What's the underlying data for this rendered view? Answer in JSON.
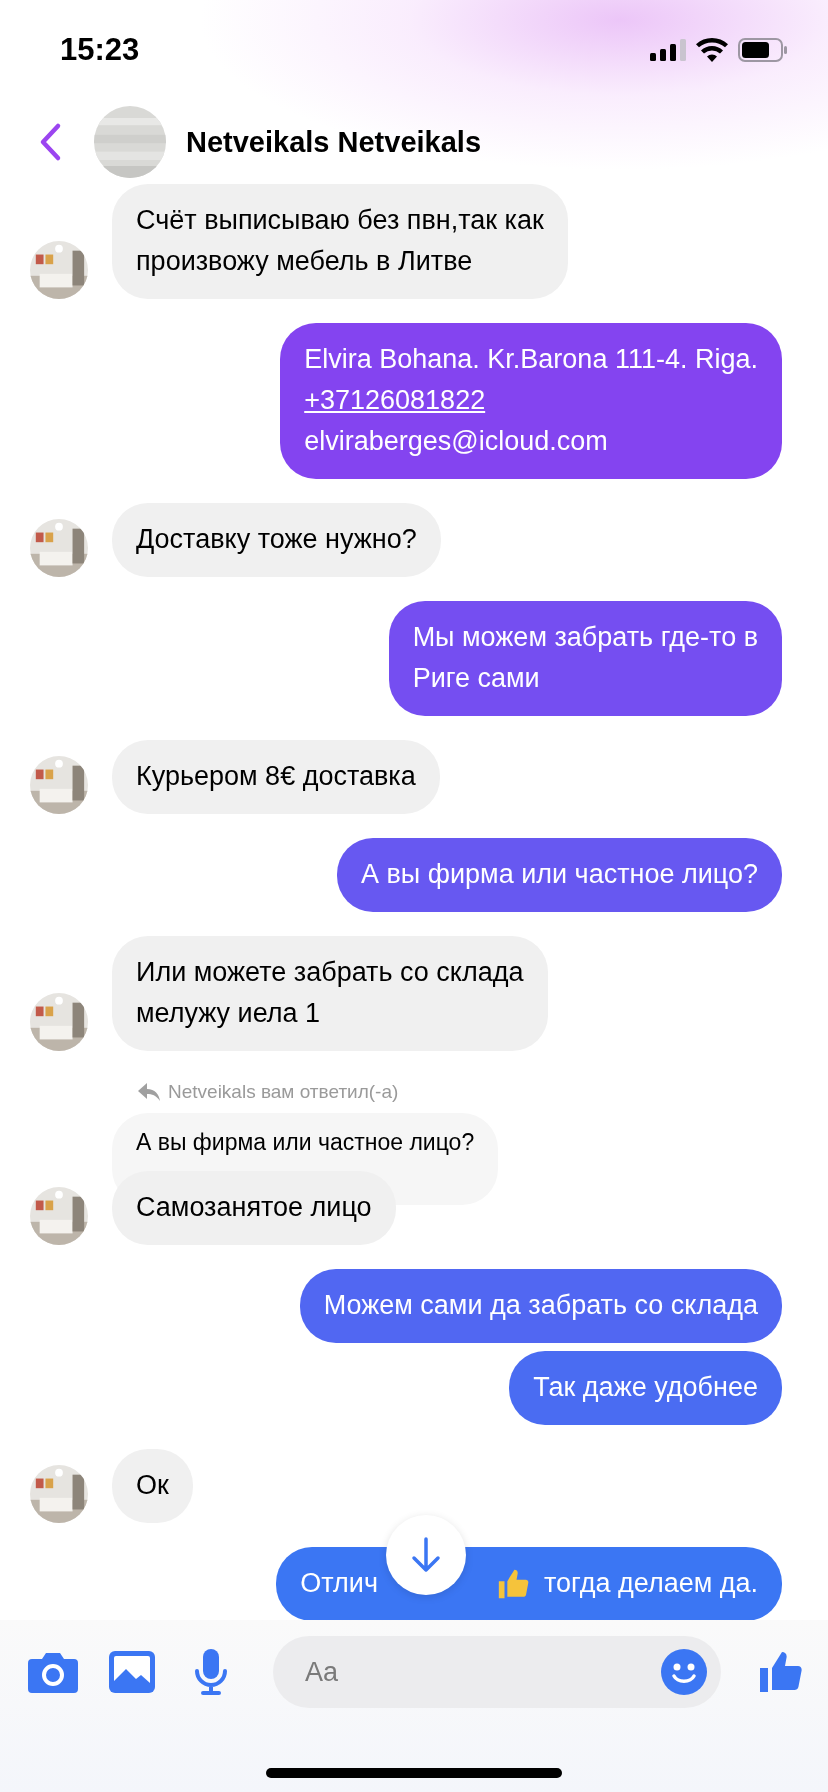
{
  "status_bar": {
    "time": "15:23"
  },
  "header": {
    "title": "Netveikals Netveikals"
  },
  "messages": [
    {
      "kind": "incoming",
      "text": "Счёт выписываю без пвн,так как\nпроизвожу мебель в Литве",
      "avatar": true
    },
    {
      "kind": "outgoing",
      "segments": [
        {
          "text": "Elvira Bohana. Kr.Barona 111-4. Riga.",
          "link": false
        },
        {
          "text": "+37126081822",
          "link": true
        },
        {
          "text": "elviraberges@icloud.com",
          "link": false
        }
      ]
    },
    {
      "kind": "incoming",
      "text": "Доставку тоже нужно?",
      "avatar": true
    },
    {
      "kind": "outgoing",
      "text": "Мы можем забрать где-то в\nРиге сами"
    },
    {
      "kind": "incoming",
      "text": "Курьером 8€ доставка",
      "avatar": true
    },
    {
      "kind": "outgoing",
      "text": "А вы фирма или частное лицо?"
    },
    {
      "kind": "incoming",
      "text": "Или можете забрать со склада\nмелужу иела 1",
      "avatar": true
    },
    {
      "kind": "incoming",
      "text": "Самозанятое лицо",
      "avatar": true,
      "reply": {
        "label": "Netveikals вам ответил(-а)",
        "quote": "А вы фирма или частное лицо?"
      }
    },
    {
      "kind": "outgoing",
      "text": "Можем сами да забрать со склада"
    },
    {
      "kind": "outgoing",
      "text": "Так даже удобнее"
    },
    {
      "kind": "incoming",
      "text": "Ок",
      "avatar": true
    },
    {
      "kind": "outgoing",
      "text": "Отлич",
      "thumbs_up": true,
      "text_after": "тогда делаем да."
    }
  ],
  "composer": {
    "placeholder": "Aa"
  }
}
